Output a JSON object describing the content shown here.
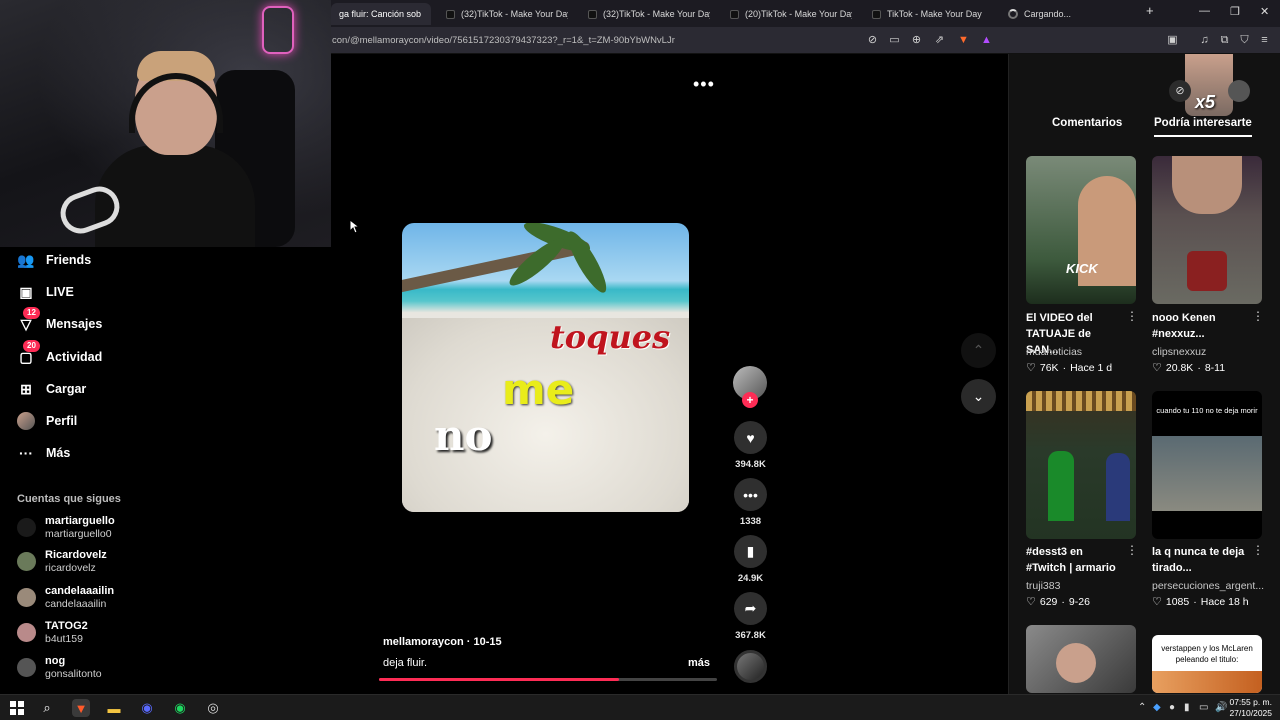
{
  "browser": {
    "tabs": [
      {
        "label": "ga fluir: Canción sob",
        "active": true
      },
      {
        "label": "(32)TikTok - Make Your Day"
      },
      {
        "label": "(32)TikTok - Make Your Day"
      },
      {
        "label": "(20)TikTok - Make Your Day"
      },
      {
        "label": "TikTok - Make Your Day"
      },
      {
        "label": "Cargando..."
      }
    ],
    "new_tab": "+",
    "url": "con/@mellamoraycon/video/7561517230379437323?_r=1&_t=ZM-90bYbWNvLJr"
  },
  "sidebar": {
    "items": [
      {
        "label": "Friends",
        "icon": "friends-icon",
        "glyph": "👥"
      },
      {
        "label": "LIVE",
        "icon": "live-icon",
        "glyph": "📺"
      },
      {
        "label": "Mensajes",
        "icon": "messages-icon",
        "glyph": "✉",
        "badge": "12"
      },
      {
        "label": "Actividad",
        "icon": "activity-icon",
        "glyph": "💬",
        "badge": "20"
      },
      {
        "label": "Cargar",
        "icon": "upload-icon",
        "glyph": "⊞"
      },
      {
        "label": "Perfil",
        "icon": "profile-icon",
        "glyph": "●"
      },
      {
        "label": "Más",
        "icon": "more-icon",
        "glyph": "···"
      }
    ],
    "following_title": "Cuentas que sigues",
    "following": [
      {
        "name": "martiarguello",
        "user": "martiarguello0"
      },
      {
        "name": "Ricardovelz",
        "user": "ricardovelz"
      },
      {
        "name": "candelaaailin",
        "user": "candelaaailin"
      },
      {
        "name": "TATOG2",
        "user": "b4ut159"
      },
      {
        "name": "nog",
        "user": "gonsalitonto"
      }
    ]
  },
  "video": {
    "overlay_words": [
      "toques",
      "me",
      "no"
    ],
    "creator": "mellamoraycon · 10-15",
    "description": "deja fluir.",
    "more": "más",
    "progress": 0.71
  },
  "actions": {
    "likes": "394.8K",
    "comments": "1338",
    "saves": "24.9K",
    "shares": "367.8K"
  },
  "right_panel": {
    "tabs": [
      "Comentarios",
      "Podría interesarte"
    ],
    "cam_label": "x5",
    "cards": [
      {
        "title": "El VIDEO del TATUAJE de SAN...",
        "author": "mdanoticias",
        "likes": "76K",
        "date": "Hace 1 d",
        "thumb_text": "KICK"
      },
      {
        "title": "nooo Kenen #nexxuz...",
        "author": "clipsnexxuz",
        "likes": "20.8K",
        "date": "8-11",
        "thumb_text": ""
      },
      {
        "title": "#desst3 en #Twitch | armario",
        "author": "truji383",
        "likes": "629",
        "date": "9-26",
        "thumb_text": ""
      },
      {
        "title": "la q nunca te deja tirado...",
        "author": "persecuciones_argent...",
        "likes": "1085",
        "date": "Hace 18 h",
        "thumb_text": "cuando tu 110 no te deja morir"
      },
      {
        "title": "",
        "author": "",
        "likes": "",
        "date": "",
        "thumb_text": ""
      },
      {
        "title": "",
        "author": "",
        "likes": "",
        "date": "",
        "thumb_text": "verstappen y los McLaren peleando el titulo:"
      }
    ]
  },
  "taskbar": {
    "time": "07:55 p. m.",
    "date": "27/10/2025"
  }
}
